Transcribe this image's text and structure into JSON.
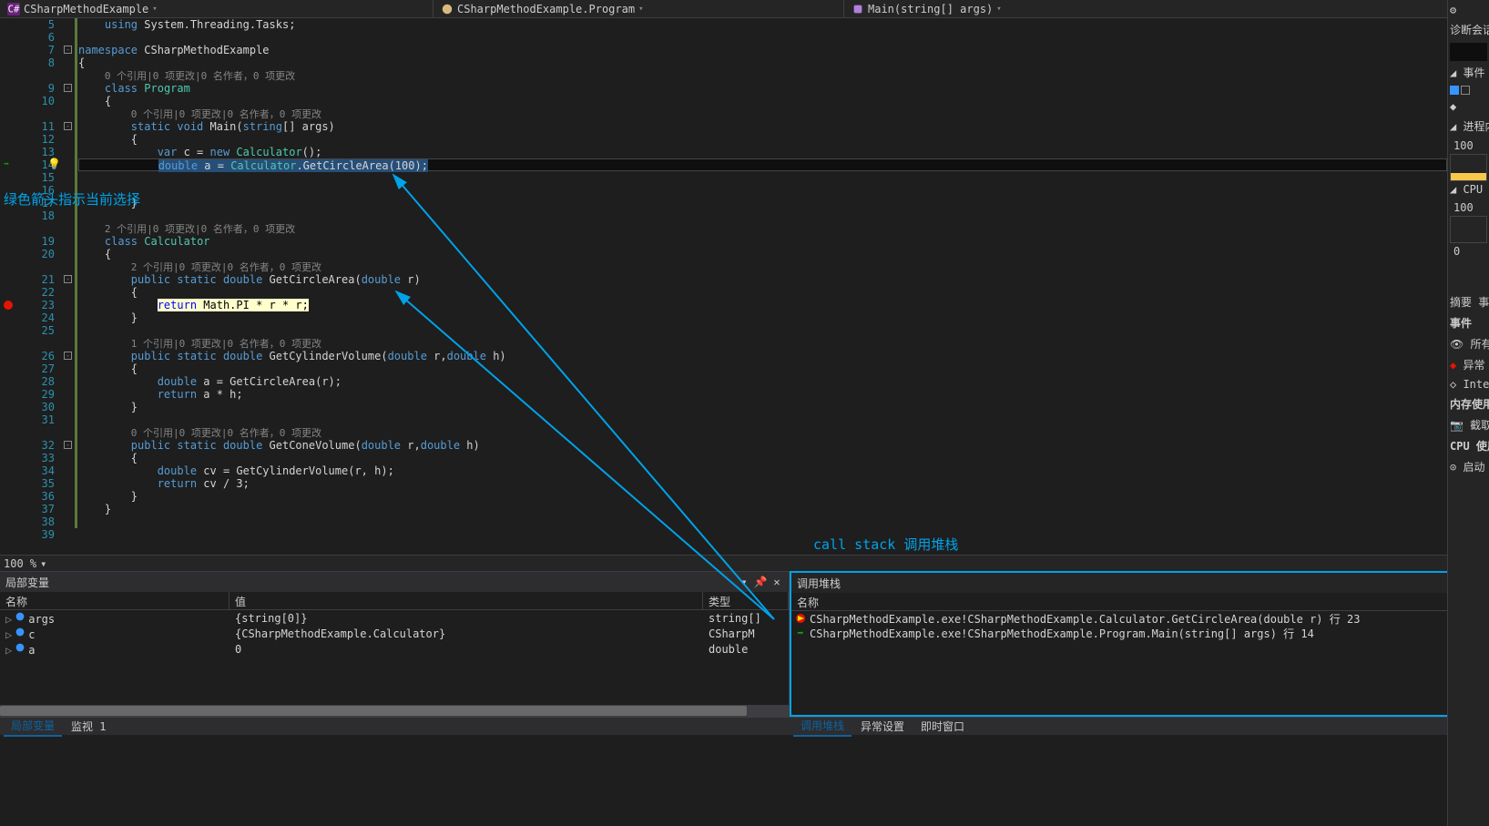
{
  "breadcrumbs": {
    "project": "CSharpMethodExample",
    "class": "CSharpMethodExample.Program",
    "method": "Main(string[] args)"
  },
  "code": {
    "lines": [
      {
        "n": 5,
        "indent": "    ",
        "tokens": [
          {
            "t": "using ",
            "c": "kw"
          },
          {
            "t": "System.Threading.Tasks;",
            "c": ""
          }
        ]
      },
      {
        "n": 6,
        "blank": true
      },
      {
        "n": 7,
        "fold": "-",
        "indent": "",
        "tokens": [
          {
            "t": "namespace ",
            "c": "kw"
          },
          {
            "t": "CSharpMethodExample",
            "c": ""
          }
        ]
      },
      {
        "n": 8,
        "indent": "",
        "tokens": [
          {
            "t": "{",
            "c": ""
          }
        ]
      },
      {
        "n": null,
        "codelens": "0 个引用|0 项更改|0 名作者，0 项更改",
        "indent": "    "
      },
      {
        "n": 9,
        "fold": "-",
        "indent": "    ",
        "tokens": [
          {
            "t": "class ",
            "c": "kw"
          },
          {
            "t": "Program",
            "c": "type"
          }
        ]
      },
      {
        "n": 10,
        "indent": "    ",
        "tokens": [
          {
            "t": "{",
            "c": ""
          }
        ]
      },
      {
        "n": null,
        "codelens": "0 个引用|0 项更改|0 名作者，0 项更改",
        "indent": "        "
      },
      {
        "n": 11,
        "fold": "-",
        "indent": "        ",
        "tokens": [
          {
            "t": "static ",
            "c": "kw"
          },
          {
            "t": "void ",
            "c": "kw"
          },
          {
            "t": "Main(",
            "c": ""
          },
          {
            "t": "string",
            "c": "kw"
          },
          {
            "t": "[] args)",
            "c": ""
          }
        ]
      },
      {
        "n": 12,
        "indent": "        ",
        "tokens": [
          {
            "t": "{",
            "c": ""
          }
        ]
      },
      {
        "n": 13,
        "indent": "            ",
        "tokens": [
          {
            "t": "var ",
            "c": "kw"
          },
          {
            "t": "c = ",
            "c": ""
          },
          {
            "t": "new ",
            "c": "kw"
          },
          {
            "t": "Calculator",
            "c": "type"
          },
          {
            "t": "();",
            "c": ""
          }
        ]
      },
      {
        "n": 14,
        "current": true,
        "indent": "            ",
        "sel": true,
        "tokens": [
          {
            "t": "double ",
            "c": "kw"
          },
          {
            "t": "a = ",
            "c": ""
          },
          {
            "t": "Calculator",
            "c": "type"
          },
          {
            "t": ".GetCircleArea(100);",
            "c": ""
          }
        ]
      },
      {
        "n": 15,
        "blank": true
      },
      {
        "n": 16,
        "blank": true
      },
      {
        "n": 17,
        "indent": "        ",
        "tokens": [
          {
            "t": "}",
            "c": ""
          }
        ]
      },
      {
        "n": 18,
        "blank": true
      },
      {
        "n": null,
        "codelens": "2 个引用|0 项更改|0 名作者，0 项更改",
        "indent": "    "
      },
      {
        "n": 19,
        "indent": "    ",
        "tokens": [
          {
            "t": "class ",
            "c": "kw"
          },
          {
            "t": "Calculator",
            "c": "type"
          }
        ]
      },
      {
        "n": 20,
        "indent": "    ",
        "tokens": [
          {
            "t": "{",
            "c": ""
          }
        ]
      },
      {
        "n": null,
        "codelens": "2 个引用|0 项更改|0 名作者，0 项更改",
        "indent": "        "
      },
      {
        "n": 21,
        "fold": "-",
        "indent": "        ",
        "tokens": [
          {
            "t": "public ",
            "c": "kw"
          },
          {
            "t": "static ",
            "c": "kw"
          },
          {
            "t": "double ",
            "c": "kw"
          },
          {
            "t": "GetCircleArea(",
            "c": ""
          },
          {
            "t": "double ",
            "c": "kw"
          },
          {
            "t": "r)",
            "c": ""
          }
        ]
      },
      {
        "n": 22,
        "indent": "        ",
        "tokens": [
          {
            "t": "{",
            "c": ""
          }
        ]
      },
      {
        "n": 23,
        "bp": true,
        "hl": true,
        "indent": "            ",
        "tokens": [
          {
            "t": "return ",
            "c": "kw"
          },
          {
            "t": "Math.PI * r * r;",
            "c": ""
          }
        ]
      },
      {
        "n": 24,
        "indent": "        ",
        "tokens": [
          {
            "t": "}",
            "c": ""
          }
        ]
      },
      {
        "n": 25,
        "blank": true
      },
      {
        "n": null,
        "codelens": "1 个引用|0 项更改|0 名作者，0 项更改",
        "indent": "        "
      },
      {
        "n": 26,
        "fold": "-",
        "indent": "        ",
        "tokens": [
          {
            "t": "public ",
            "c": "kw"
          },
          {
            "t": "static ",
            "c": "kw"
          },
          {
            "t": "double ",
            "c": "kw"
          },
          {
            "t": "GetCylinderVolume(",
            "c": ""
          },
          {
            "t": "double ",
            "c": "kw"
          },
          {
            "t": "r,",
            "c": ""
          },
          {
            "t": "double ",
            "c": "kw"
          },
          {
            "t": "h)",
            "c": ""
          }
        ]
      },
      {
        "n": 27,
        "indent": "        ",
        "tokens": [
          {
            "t": "{",
            "c": ""
          }
        ]
      },
      {
        "n": 28,
        "indent": "            ",
        "tokens": [
          {
            "t": "double ",
            "c": "kw"
          },
          {
            "t": "a = GetCircleArea(r);",
            "c": ""
          }
        ]
      },
      {
        "n": 29,
        "indent": "            ",
        "tokens": [
          {
            "t": "return ",
            "c": "kw"
          },
          {
            "t": "a * h;",
            "c": ""
          }
        ]
      },
      {
        "n": 30,
        "indent": "        ",
        "tokens": [
          {
            "t": "}",
            "c": ""
          }
        ]
      },
      {
        "n": 31,
        "blank": true
      },
      {
        "n": null,
        "codelens": "0 个引用|0 项更改|0 名作者，0 项更改",
        "indent": "        "
      },
      {
        "n": 32,
        "fold": "-",
        "indent": "        ",
        "tokens": [
          {
            "t": "public ",
            "c": "kw"
          },
          {
            "t": "static ",
            "c": "kw"
          },
          {
            "t": "double ",
            "c": "kw"
          },
          {
            "t": "GetConeVolume(",
            "c": ""
          },
          {
            "t": "double ",
            "c": "kw"
          },
          {
            "t": "r,",
            "c": ""
          },
          {
            "t": "double ",
            "c": "kw"
          },
          {
            "t": "h)",
            "c": ""
          }
        ]
      },
      {
        "n": 33,
        "indent": "        ",
        "tokens": [
          {
            "t": "{",
            "c": ""
          }
        ]
      },
      {
        "n": 34,
        "indent": "            ",
        "tokens": [
          {
            "t": "double ",
            "c": "kw"
          },
          {
            "t": "cv = GetCylinderVolume(r, h);",
            "c": ""
          }
        ]
      },
      {
        "n": 35,
        "indent": "            ",
        "tokens": [
          {
            "t": "return ",
            "c": "kw"
          },
          {
            "t": "cv / 3;",
            "c": ""
          }
        ]
      },
      {
        "n": 36,
        "indent": "        ",
        "tokens": [
          {
            "t": "}",
            "c": ""
          }
        ]
      },
      {
        "n": 37,
        "indent": "    ",
        "tokens": [
          {
            "t": "}",
            "c": ""
          }
        ]
      },
      {
        "n": 38,
        "blank": true
      },
      {
        "n": 39,
        "blank": true
      }
    ]
  },
  "zoom": "100 %",
  "annotations": {
    "green_arrow": "绿色箭头指示当前选择",
    "callstack": "call stack 调用堆栈"
  },
  "locals": {
    "title": "局部变量",
    "cols": {
      "name": "名称",
      "value": "值",
      "type": "类型"
    },
    "rows": [
      {
        "name": "args",
        "value": "{string[0]}",
        "type": "string[]"
      },
      {
        "name": "c",
        "value": "{CSharpMethodExample.Calculator}",
        "type": "CSharpM"
      },
      {
        "name": "a",
        "value": "0",
        "type": "double"
      }
    ],
    "tabs": [
      "局部变量",
      "监视 1"
    ]
  },
  "callstack": {
    "title": "调用堆栈",
    "col_name": "名称",
    "rows": [
      {
        "icon": "bp",
        "text": "CSharpMethodExample.exe!CSharpMethodExample.Calculator.GetCircleArea(double r) 行 23"
      },
      {
        "icon": "arrow",
        "text": "CSharpMethodExample.exe!CSharpMethodExample.Program.Main(string[] args) 行 14"
      }
    ],
    "tabs": [
      "调用堆栈",
      "异常设置",
      "即时窗口"
    ]
  },
  "diag": {
    "title": "诊断会话",
    "events": "事件",
    "process": "进程内",
    "val_100a": "100",
    "cpu": "CPU (",
    "val_100b": "100",
    "val_0": "0",
    "summary": "摘要  事",
    "evhdr": "事件",
    "all": "所有",
    "ex": "异常",
    "intelli": "Inte",
    "mem": "内存使用",
    "snap": "截取",
    "cpuUse": "CPU 使用",
    "start": "启动"
  }
}
